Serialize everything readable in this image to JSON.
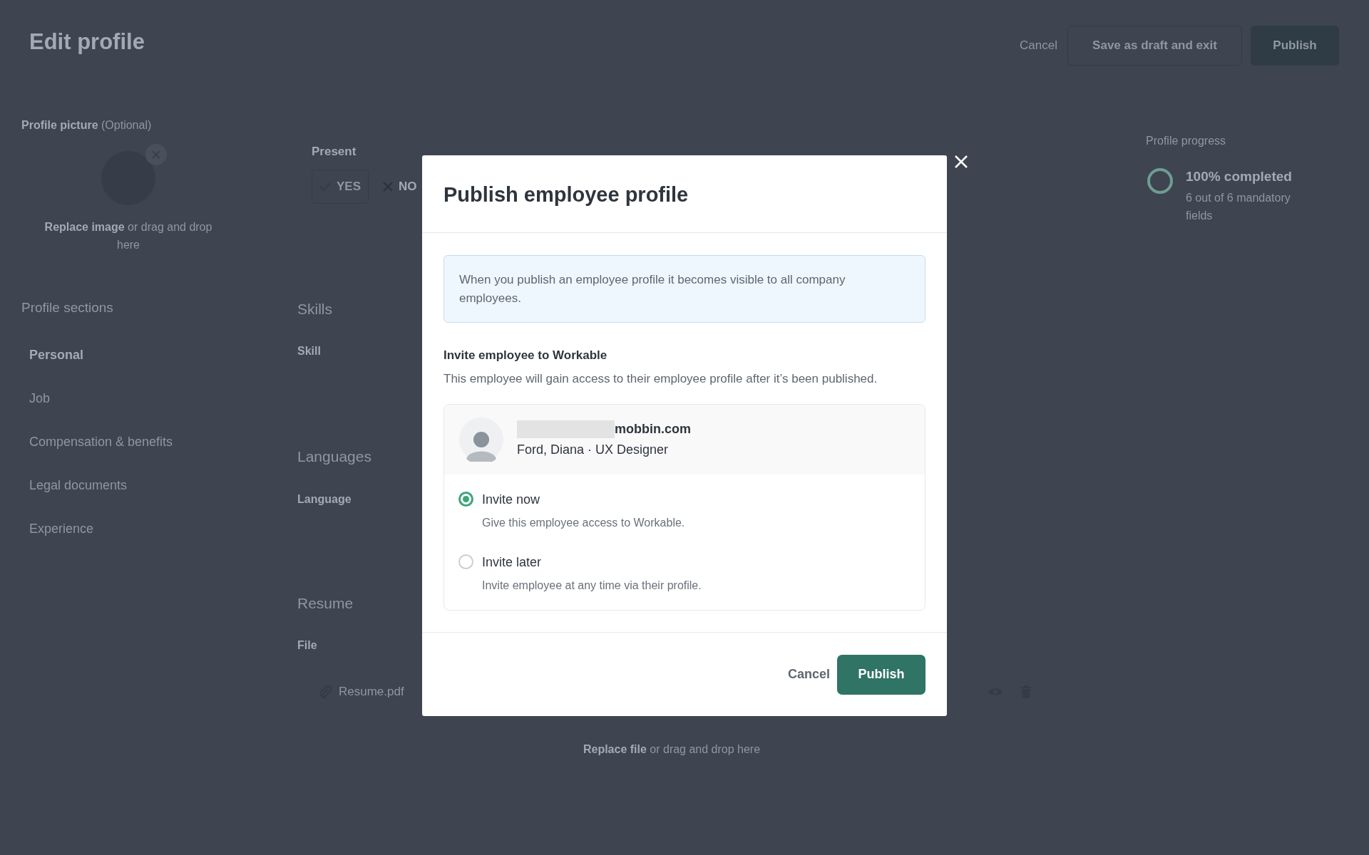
{
  "page": {
    "title": "Edit profile",
    "header_actions": [
      {
        "label": "Cancel",
        "kind": "link"
      },
      {
        "label": "Save as draft and exit",
        "kind": "outline"
      },
      {
        "label": "Publish",
        "kind": "primary"
      }
    ],
    "profile_picture": {
      "label": "Profile picture",
      "hint": "(Optional)",
      "upload_prompt": "**Replace image** or drag and drop here"
    },
    "profile_sections": {
      "title": "Profile sections",
      "items": [
        {
          "label": "Personal",
          "selected": true
        },
        {
          "label": "Job",
          "selected": false
        },
        {
          "label": "Compensation & benefits",
          "selected": false
        },
        {
          "label": "Legal documents",
          "selected": false
        },
        {
          "label": "Experience",
          "selected": false
        }
      ]
    },
    "present": {
      "label": "Present",
      "options": [
        {
          "label": "YES",
          "selected": true
        },
        {
          "label": "NO",
          "selected": false
        }
      ]
    },
    "sections": [
      {
        "title": "Skills",
        "field_label": "Skill"
      },
      {
        "title": "Languages",
        "field_label": "Language"
      },
      {
        "title": "Resume",
        "field_label": "File"
      }
    ],
    "resume_file": {
      "name": "Resume.pdf",
      "replace_prompt": "**Replace file** or drag and drop here"
    },
    "profile_progress": {
      "title": "Profile progress",
      "level": 1,
      "status": "100% completed",
      "detail": "6 out of 6 mandatory fields"
    }
  },
  "dialog": {
    "title": "Publish employee profile",
    "info": "When you publish an employee profile it becomes visible to all company employees.",
    "invite_title": "Invite employee to Workable",
    "invite_description": "This employee will gain access to their employee profile after it’s been published.",
    "employee": {
      "email": "mobbin.com",
      "email_redacted": true,
      "subtitle": "Ford, Diana · UX Designer"
    },
    "options": [
      {
        "label": "Invite now",
        "description": "Give this employee access to Workable.",
        "selected": true
      },
      {
        "label": "Invite later",
        "description": "Invite employee at any time via their profile.",
        "selected": false
      }
    ],
    "actions": [
      {
        "label": "Cancel",
        "kind": "link"
      },
      {
        "label": "Publish",
        "kind": "primary"
      }
    ]
  }
}
